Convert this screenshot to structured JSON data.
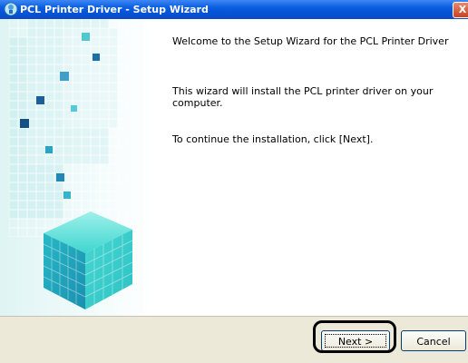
{
  "window": {
    "title": "PCL Printer Driver - Setup Wizard",
    "close_label": "X"
  },
  "wizard": {
    "heading": "Welcome to the Setup Wizard for the PCL Printer Driver",
    "body_line1": "This wizard will install the PCL printer driver on your",
    "body_line2": "computer.",
    "instruction": "To continue the installation, click [Next]."
  },
  "buttons": {
    "next_label": "Next >",
    "cancel_label": "Cancel"
  },
  "colors": {
    "titlebar": "#0a5ee0",
    "cube": "#3fd6d0",
    "panel": "#ece9d8"
  }
}
